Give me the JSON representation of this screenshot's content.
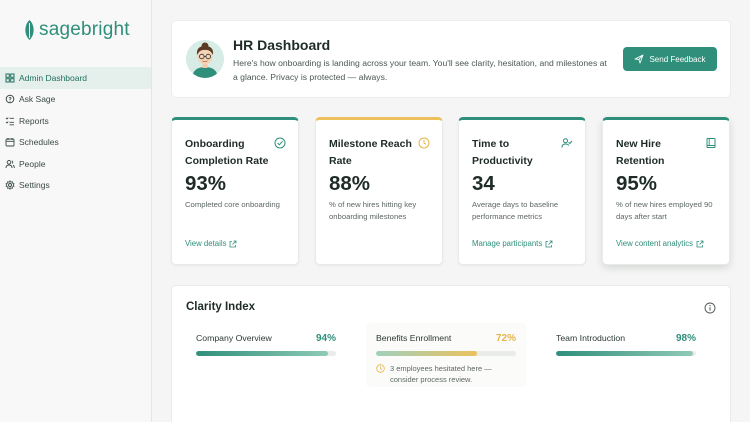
{
  "brand": {
    "name": "sagebright"
  },
  "sidebar": {
    "items": [
      {
        "label": "Admin Dashboard",
        "icon": "dashboard-icon"
      },
      {
        "label": "Ask Sage",
        "icon": "chat-icon"
      },
      {
        "label": "Reports",
        "icon": "list-icon"
      },
      {
        "label": "Schedules",
        "icon": "calendar-icon"
      },
      {
        "label": "People",
        "icon": "users-icon"
      },
      {
        "label": "Settings",
        "icon": "gear-icon"
      }
    ],
    "active": "Admin Dashboard"
  },
  "header": {
    "title": "HR Dashboard",
    "description": "Here's how onboarding is landing across your team. You'll see clarity, hesitation, and milestones at a glance. Privacy is protected — always.",
    "feedback_button": "Send Feedback"
  },
  "metrics": [
    {
      "title": "Onboarding Completion Rate",
      "value": "93%",
      "description": "Completed core onboarding",
      "link": "View details",
      "icon": "check-circle-icon"
    },
    {
      "title": "Milestone Reach Rate",
      "value": "88%",
      "description": "% of new hires hitting key onboarding milestones",
      "link": "",
      "icon": "clock-icon"
    },
    {
      "title": "Time to Productivity",
      "value": "34",
      "description": "Average days to baseline performance metrics",
      "link": "Manage participants",
      "icon": "user-check-icon"
    },
    {
      "title": "New Hire Retention",
      "value": "95%",
      "description": "% of new hires employed 90 days after start",
      "link": "View content analytics",
      "icon": "book-icon"
    }
  ],
  "clarity": {
    "title": "Clarity Index",
    "items": [
      {
        "name": "Company Overview",
        "value": "94%",
        "fill": 0.94
      },
      {
        "name": "Benefits Enrollment",
        "value": "72%",
        "fill": 0.72,
        "note": "3 employees hesitated here — consider process review."
      },
      {
        "name": "Team Introduction",
        "value": "98%",
        "fill": 0.98
      }
    ]
  },
  "colors": {
    "accent": "#2f8f7b",
    "warning": "#ecc15c",
    "background": "#f4f5f4"
  }
}
